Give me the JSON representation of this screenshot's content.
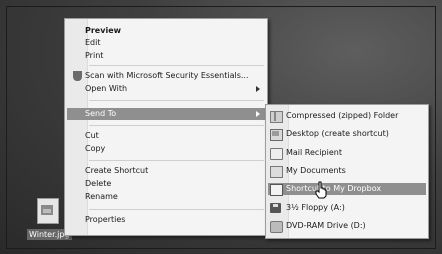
{
  "desktop": {
    "file": {
      "name": "Winter.jpg",
      "icon": "image-file-icon"
    }
  },
  "context_menu": {
    "items": [
      {
        "label": "Preview",
        "bold": true
      },
      {
        "label": "Edit"
      },
      {
        "label": "Print"
      },
      {
        "label": "Scan with Microsoft Security Essentials...",
        "icon": "security-shield-icon"
      },
      {
        "label": "Open With",
        "submenu": true
      },
      {
        "label": "Send To",
        "submenu": true,
        "highlighted": true
      },
      {
        "label": "Cut"
      },
      {
        "label": "Copy"
      },
      {
        "label": "Create Shortcut"
      },
      {
        "label": "Delete"
      },
      {
        "label": "Rename"
      },
      {
        "label": "Properties"
      }
    ]
  },
  "send_to_menu": {
    "items": [
      {
        "label": "Compressed (zipped) Folder",
        "icon": "zip-folder-icon"
      },
      {
        "label": "Desktop (create shortcut)",
        "icon": "desktop-icon"
      },
      {
        "label": "Mail Recipient",
        "icon": "mail-icon"
      },
      {
        "label": "My Documents",
        "icon": "documents-icon"
      },
      {
        "label": "Shortcut to My Dropbox",
        "icon": "dropbox-icon",
        "highlighted": true
      },
      {
        "label": "3½ Floppy (A:)",
        "icon": "floppy-drive-icon"
      },
      {
        "label": "DVD-RAM Drive (D:)",
        "icon": "dvd-drive-icon"
      }
    ]
  }
}
